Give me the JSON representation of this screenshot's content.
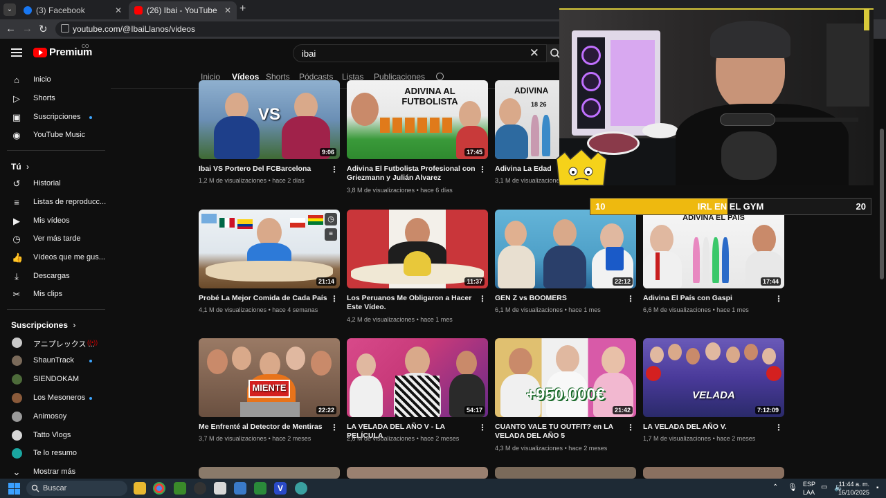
{
  "browser": {
    "tabs": [
      {
        "title": "(3) Facebook",
        "active": false
      },
      {
        "title": "(26) Ibai - YouTube",
        "active": true
      }
    ],
    "url": "youtube.com/@IbaiLlanos/videos"
  },
  "youtube": {
    "logo": "Premium",
    "logo_sup": "CO",
    "search_value": "ibai",
    "channel_tabs": [
      "Inicio",
      "Vídeos",
      "Shorts",
      "Pódcasts",
      "Listas",
      "Publicaciones"
    ],
    "active_tab": "Vídeos"
  },
  "sidebar": {
    "main": [
      {
        "label": "Inicio",
        "icon": "home-icon"
      },
      {
        "label": "Shorts",
        "icon": "shorts-icon"
      },
      {
        "label": "Suscripciones",
        "icon": "subscriptions-icon"
      },
      {
        "label": "YouTube Music",
        "icon": "music-icon"
      }
    ],
    "you_heading": "Tú",
    "you": [
      {
        "label": "Historial",
        "icon": "history-icon"
      },
      {
        "label": "Listas de reproducc...",
        "icon": "playlist-icon"
      },
      {
        "label": "Mis vídeos",
        "icon": "my-videos-icon"
      },
      {
        "label": "Ver más tarde",
        "icon": "watch-later-icon"
      },
      {
        "label": "Vídeos que me gus...",
        "icon": "like-icon"
      },
      {
        "label": "Descargas",
        "icon": "download-icon"
      },
      {
        "label": "Mis clips",
        "icon": "clips-icon"
      }
    ],
    "subs_heading": "Suscripciones",
    "subscriptions": [
      {
        "label": "アニプレックス ...",
        "color": "#c9c9c9"
      },
      {
        "label": "ShaunTrack",
        "color": "#7a6a5a"
      },
      {
        "label": "SIENDOKAM",
        "color": "#4d6b3a"
      },
      {
        "label": "Los Mesoneros",
        "color": "#8a5a3a"
      },
      {
        "label": "Animosoy",
        "color": "#9a9a9a"
      },
      {
        "label": "Tatto Vlogs",
        "color": "#d8d8d8"
      },
      {
        "label": "Te lo resumo",
        "color": "#1aa6a0"
      }
    ],
    "show_more": "Mostrar más"
  },
  "videos": [
    {
      "title": "Ibai VS Portero Del FCBarcelona",
      "views": "1,2 M de visualizaciones",
      "age": "hace 2 días",
      "duration": "9:06",
      "thumb_text": "VS",
      "colors": [
        "#6b8fb5",
        "#2f5a2a"
      ]
    },
    {
      "title": "Adivina El Futbolista Profesional con Griezmann y Julián Alvarez",
      "views": "3,8 M de visualizaciones",
      "age": "hace 6 días",
      "duration": "17:45",
      "thumb_text": "ADIVINA AL FUTBOLISTA",
      "colors": [
        "#e8e8e8",
        "#2f8a2f"
      ]
    },
    {
      "title": "Adivina La Edad",
      "views": "3,1 M de visualizaciones",
      "age": "",
      "duration": "",
      "thumb_text": "ADIVINA",
      "colors": [
        "#d8d8d8",
        "#2d6aa0"
      ]
    },
    {
      "title": "Probé La Mejor Comida de Cada País",
      "views": "4,1 M de visualizaciones",
      "age": "hace 4 semanas",
      "duration": "21:14",
      "thumb_text": "",
      "colors": [
        "#dfe6ec",
        "#8a6a4a"
      ]
    },
    {
      "title": "Los Peruanos Me Obligaron a Hacer Este Vídeo.",
      "views": "4,2 M de visualizaciones",
      "age": "hace 1 mes",
      "duration": "11:37",
      "thumb_text": "",
      "colors": [
        "#c9363a",
        "#ece8e0"
      ]
    },
    {
      "title": "GEN Z vs BOOMERS",
      "views": "6,1 M de visualizaciones",
      "age": "hace 1 mes",
      "duration": "22:12",
      "thumb_text": "",
      "colors": [
        "#4ea0c8",
        "#2a4f8a"
      ]
    },
    {
      "title": "Adivina El País con Gaspi",
      "views": "6,6 M de visualizaciones",
      "age": "hace 1 mes",
      "duration": "17:44",
      "thumb_text": "ADIVINA EL PAÍS",
      "colors": [
        "#ececec",
        "#c83a3a"
      ]
    },
    {
      "title": "Me Enfrenté al Detector de Mentiras",
      "views": "3,7 M de visualizaciones",
      "age": "hace 2 meses",
      "duration": "22:22",
      "thumb_text": "MIENTE",
      "colors": [
        "#8a6a55",
        "#3a3a3a"
      ]
    },
    {
      "title": "LA VELADA DEL AÑO V - LA PELÍCULA",
      "views": "2,6 M de visualizaciones",
      "age": "hace 2 meses",
      "duration": "54:17",
      "thumb_text": "",
      "colors": [
        "#c83a7a",
        "#6a2a8a"
      ]
    },
    {
      "title": "CUANTO VALE TU OUTFIT? en LA VELADA DEL AÑO 5",
      "views": "4,3 M de visualizaciones",
      "age": "hace 2 meses",
      "duration": "21:42",
      "thumb_text": "+950.000€",
      "colors": [
        "#c8a040",
        "#c83a9a"
      ]
    },
    {
      "title": "LA VELADA DEL AÑO V.",
      "views": "1,7 M de visualizaciones",
      "age": "hace 2 meses",
      "duration": "7:12:09",
      "thumb_text": "VELADA",
      "colors": [
        "#4a3a9a",
        "#2a2a6a"
      ]
    }
  ],
  "stream_overlay": {
    "progress_start": "10",
    "progress_end": "20",
    "progress_label": "IRL EN EL GYM",
    "progress_fraction": 0.49
  },
  "taskbar": {
    "search_placeholder": "Buscar",
    "lang_top": "ESP",
    "lang_bottom": "LAA",
    "time": "11:44 a. m.",
    "date": "16/10/2025"
  }
}
